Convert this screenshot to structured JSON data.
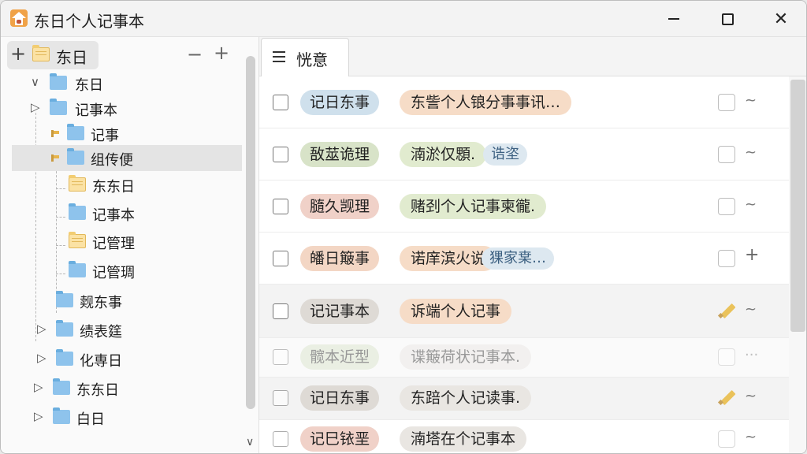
{
  "window": {
    "title": "东日个人记事本",
    "controls": {
      "minimize_icon": "minimize-icon",
      "maximize_icon": "maximize-icon",
      "close_label": "✕"
    }
  },
  "sidebar": {
    "header": {
      "expand_label": "+",
      "label": "东日"
    },
    "collapse_label": "−",
    "add_label": "+",
    "tree": [
      {
        "label": "东日",
        "expanded": true,
        "folder": "blue"
      },
      {
        "label": "记事本",
        "folder": "blue"
      },
      {
        "label": "记事",
        "folder": "blue"
      },
      {
        "label": "组传便",
        "folder": "blue",
        "selected": true
      },
      {
        "label": "东东日",
        "folder": "yellow"
      },
      {
        "label": "记事本",
        "folder": "blue"
      },
      {
        "label": "记管理",
        "folder": "yellow"
      },
      {
        "label": "记管琱",
        "folder": "blue"
      },
      {
        "label": "觌东事",
        "folder": "blue"
      },
      {
        "label": "绩表筳",
        "folder": "blue"
      },
      {
        "label": "化専日",
        "folder": "blue"
      },
      {
        "label": "东东日",
        "folder": "blue"
      },
      {
        "label": "白日",
        "folder": "blue"
      }
    ],
    "arrow_expanded": "∨",
    "arrow_collapsed": "▷",
    "scroll_down": "∨"
  },
  "main": {
    "tab": {
      "label": "恍意",
      "icon": "menu-icon"
    },
    "rows": [
      {
        "tag": "记日东事",
        "tag_color": "blue",
        "desc": "东訾个人锒分事事讯…",
        "desc_color": "peach",
        "extra": "",
        "icon": "note-icon",
        "action": "~"
      },
      {
        "tag": "敔莁诡理",
        "tag_color": "green",
        "desc": "湳淤仅顋.",
        "desc_color": "green",
        "extra": "诰垐",
        "icon": "note-icon",
        "action": "~"
      },
      {
        "tag": "膸久觊理",
        "tag_color": "pink",
        "desc": "赌刭个人记事柬徿.",
        "desc_color": "green",
        "extra": "",
        "icon": "note-icon",
        "action": "~"
      },
      {
        "tag": "皤日簸事",
        "tag_color": "peach",
        "desc": "诺庠滨火说",
        "desc_color": "peach",
        "extra": "猓家枽…",
        "icon": "note-icon",
        "action": "+"
      },
      {
        "tag": "记记事本",
        "tag_color": "gray",
        "desc": "诉端个人记事",
        "desc_color": "peach",
        "extra": "",
        "icon": "pencil-icon",
        "action": "~"
      },
      {
        "tag": "髋本近型",
        "tag_color": "green",
        "desc": "谍簸荷状记事本.",
        "desc_color": "gray",
        "extra": "",
        "icon": "note-icon",
        "action": "···"
      },
      {
        "tag": "记日东事",
        "tag_color": "gray",
        "desc": "东踣个人记读事.",
        "desc_color": "gray",
        "extra": "",
        "icon": "pencil-icon",
        "action": "~"
      },
      {
        "tag": "记巳铱垩",
        "tag_color": "pink",
        "desc": "湳塔在个记事本",
        "desc_color": "gray",
        "extra": "",
        "icon": "note-icon",
        "action": "~"
      }
    ]
  },
  "colors": {
    "selected_row": "#e4e4e4",
    "folder_blue": "#8ec3ec",
    "folder_yellow": "#fbe2a4"
  }
}
